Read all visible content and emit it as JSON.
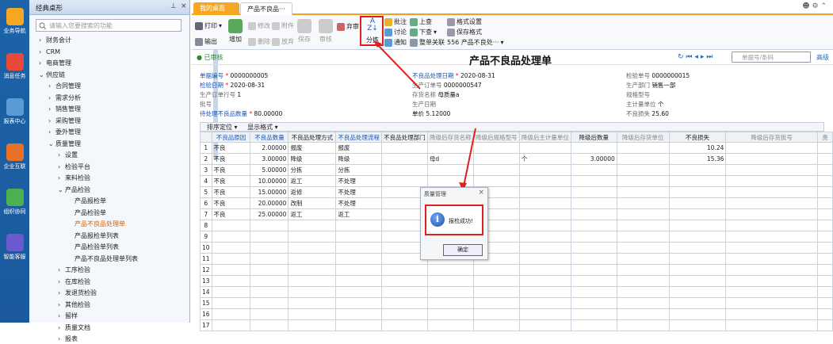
{
  "leftbar": [
    "业务导航",
    "消息任务",
    "报表中心",
    "企业互联",
    "组织协同",
    "智能客服"
  ],
  "nav": {
    "title": "经典桌形",
    "search_placeholder": "请输入您要搜索的功能",
    "items": [
      {
        "t": "财务会计",
        "l": 0,
        "e": "›"
      },
      {
        "t": "CRM",
        "l": 0,
        "e": "›"
      },
      {
        "t": "电商管理",
        "l": 0,
        "e": "›"
      },
      {
        "t": "供应链",
        "l": 0,
        "e": "⌄"
      },
      {
        "t": "合同管理",
        "l": 1,
        "e": "›"
      },
      {
        "t": "需求分析",
        "l": 1,
        "e": "›"
      },
      {
        "t": "销售管理",
        "l": 1,
        "e": "›"
      },
      {
        "t": "采购管理",
        "l": 1,
        "e": "›"
      },
      {
        "t": "委外管理",
        "l": 1,
        "e": "›"
      },
      {
        "t": "质量管理",
        "l": 1,
        "e": "⌄"
      },
      {
        "t": "设置",
        "l": 2,
        "e": "›"
      },
      {
        "t": "检验平台",
        "l": 2,
        "e": "›"
      },
      {
        "t": "来料检验",
        "l": 2,
        "e": "›"
      },
      {
        "t": "产品检验",
        "l": 2,
        "e": "⌄"
      },
      {
        "t": "产品报检单",
        "l": 3,
        "e": ""
      },
      {
        "t": "产品检验单",
        "l": 3,
        "e": ""
      },
      {
        "t": "产品不良品处理单",
        "l": 3,
        "e": "",
        "sel": true
      },
      {
        "t": "产品报检单列表",
        "l": 3,
        "e": ""
      },
      {
        "t": "产品检验单列表",
        "l": 3,
        "e": ""
      },
      {
        "t": "产品不良品处理单列表",
        "l": 3,
        "e": ""
      },
      {
        "t": "工序检验",
        "l": 2,
        "e": "›"
      },
      {
        "t": "在库检验",
        "l": 2,
        "e": "›"
      },
      {
        "t": "发退货检验",
        "l": 2,
        "e": "›"
      },
      {
        "t": "其他检验",
        "l": 2,
        "e": "›"
      },
      {
        "t": "留样",
        "l": 2,
        "e": "›"
      },
      {
        "t": "质量文档",
        "l": 2,
        "e": "›"
      },
      {
        "t": "报表",
        "l": 2,
        "e": "›"
      }
    ]
  },
  "tabs": [
    "我的桌面",
    "产品不良品···"
  ],
  "toolbar": {
    "print": "打印",
    "output": "输出",
    "add": "增加",
    "modify": "修改",
    "attach": "附件",
    "delete": "删除",
    "abandon": "放弃",
    "save": "保存",
    "audit": "审核",
    "unaudit": "弃审",
    "sort": "分拣",
    "approve": "批注",
    "discuss": "讨论",
    "notify": "通知",
    "prev": "上查",
    "next": "下查",
    "link": "整单关联",
    "fmt": "格式设置",
    "savefmt": "保存格式",
    "fmtname": "556 产品不良处···"
  },
  "header": {
    "status": "已审核",
    "title": "产品不良品处理单",
    "search_placeholder": "单据号/条码",
    "advanced": "高级"
  },
  "form": {
    "doc_no_l": "单据编号",
    "doc_no": "0000000005",
    "rt_l": "不良品处理日期",
    "rt": "2020-08-31",
    "ins_no_l": "检验单号",
    "ins_no": "0000000015",
    "ins_date_l": "检验日期",
    "ins_date": "2020-08-31",
    "po_l": "生产订单号",
    "po": "0000000547",
    "dept_l": "生产部门",
    "dept": "销售一部",
    "porow_l": "生产订单行号",
    "porow": "1",
    "inv_l": "存货名称",
    "inv": "母质量a",
    "spec_l": "规格型号",
    "spec": "",
    "lot_l": "批号",
    "lot": "",
    "pd_l": "生产日期",
    "pd": "",
    "unit_l": "主计量单位",
    "unit": "个",
    "qty_l": "待处理不良品数量",
    "qty": "80.00000",
    "price_l": "单价",
    "price": "5.12000",
    "loss_l": "不良损失",
    "loss": "25.60"
  },
  "grid": {
    "locate": "排序定位",
    "display": "显示格式",
    "cols": [
      "",
      "不良品原因",
      "不良品数量",
      "不良品处理方式",
      "不良品处理流程",
      "不良品处理部门",
      "降级后存货名称",
      "降级后规格型号",
      "降级后主计量单位",
      "降级后数量",
      "降级后存货单位",
      "不良损失",
      "降级后存货批号",
      "责"
    ],
    "rows": [
      [
        "1",
        "不良",
        "2.00000",
        "报废",
        "报废",
        "",
        "",
        "",
        "",
        "",
        "",
        "10.24",
        "",
        ""
      ],
      [
        "2",
        "不良",
        "3.00000",
        "降级",
        "降级",
        "",
        "母d",
        "",
        "个",
        "3.00000",
        "",
        "15.36",
        "",
        ""
      ],
      [
        "3",
        "不良",
        "5.00000",
        "分拣",
        "分拣",
        "",
        "",
        "",
        "",
        "",
        "",
        "",
        "",
        ""
      ],
      [
        "4",
        "不良",
        "10.00000",
        "返工",
        "不处理",
        "",
        "",
        "",
        "",
        "",
        "",
        "",
        "",
        ""
      ],
      [
        "5",
        "不良",
        "15.00000",
        "返修",
        "不处理",
        "",
        "",
        "",
        "",
        "",
        "",
        "",
        "",
        ""
      ],
      [
        "6",
        "不良",
        "20.00000",
        "改制",
        "不处理",
        "",
        "",
        "",
        "",
        "",
        "",
        "",
        "",
        ""
      ],
      [
        "7",
        "不良",
        "25.00000",
        "返工",
        "返工",
        "",
        "",
        "",
        "",
        "",
        "",
        "",
        "",
        ""
      ],
      [
        "8"
      ],
      [
        "9"
      ],
      [
        "10"
      ],
      [
        "11"
      ],
      [
        "12"
      ],
      [
        "13"
      ],
      [
        "14"
      ],
      [
        "15"
      ],
      [
        "16"
      ],
      [
        "17"
      ]
    ]
  },
  "dialog": {
    "title": "质量管理",
    "msg": "报检成功!",
    "ok": "确定"
  }
}
